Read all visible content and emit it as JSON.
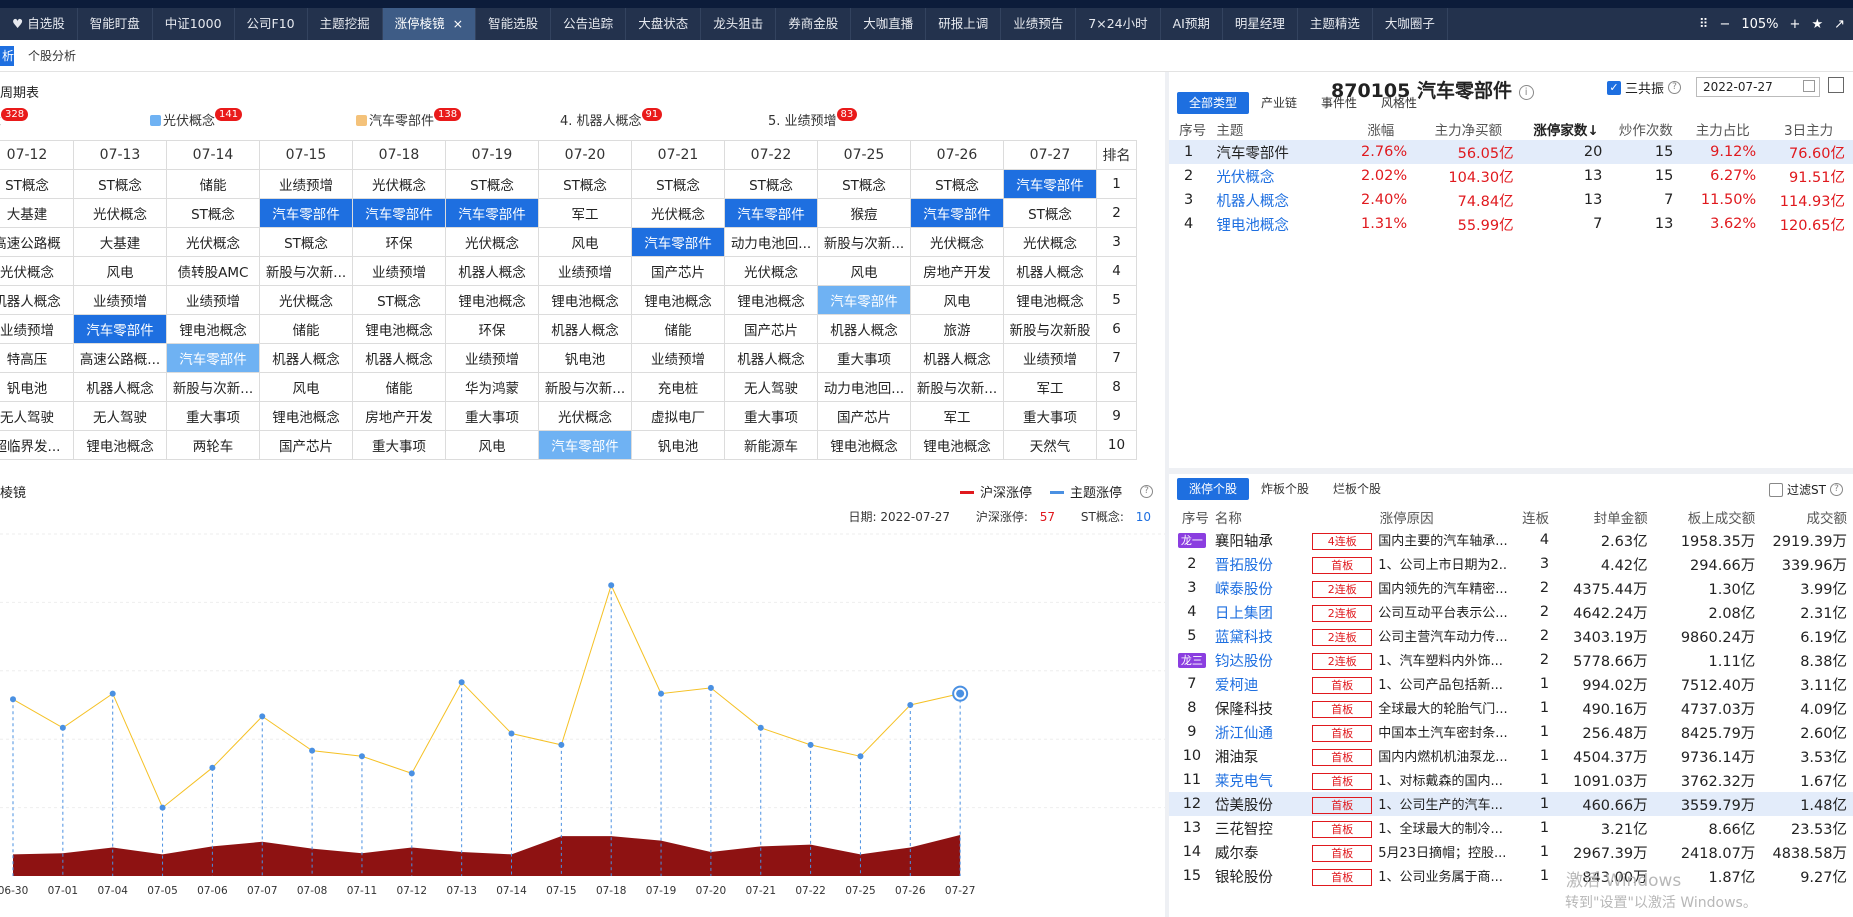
{
  "tabs": [
    "自选股",
    "智能盯盘",
    "中证1000",
    "公司F10",
    "主题挖掘",
    "涨停棱镜",
    "智能选股",
    "公告追踪",
    "大盘状态",
    "龙头狙击",
    "券商金股",
    "大咖直播",
    "研报上调",
    "业绩预告",
    "7×24小时",
    "AI预期",
    "明星经理",
    "主题精选",
    "大咖圈子"
  ],
  "active_tab": "涨停棱镜",
  "zoom": "105%",
  "subbar": {
    "left": "析",
    "right": "个股分析"
  },
  "rotation": {
    "title": "周期表",
    "pills": [
      {
        "label": "念",
        "badge": "328"
      },
      {
        "label": "光伏概念",
        "badge": "141"
      },
      {
        "label": "汽车零部件",
        "badge": "138"
      },
      {
        "label": "4. 机器人概念",
        "badge": "91"
      },
      {
        "label": "5. 业绩预增",
        "badge": "83"
      }
    ],
    "dates": [
      "07-12",
      "07-13",
      "07-14",
      "07-15",
      "07-18",
      "07-19",
      "07-20",
      "07-21",
      "07-22",
      "07-25",
      "07-26",
      "07-27"
    ],
    "rank_label": "排名",
    "rows": [
      [
        "ST概念",
        "ST概念",
        "储能",
        "业绩预增",
        "光伏概念",
        "ST概念",
        "ST概念",
        "ST概念",
        "ST概念",
        "ST概念",
        "ST概念",
        "汽车零部件"
      ],
      [
        "大基建",
        "光伏概念",
        "ST概念",
        "汽车零部件",
        "汽车零部件",
        "汽车零部件",
        "军工",
        "光伏概念",
        "汽车零部件",
        "猴痘",
        "汽车零部件",
        "ST概念"
      ],
      [
        "高速公路概",
        "大基建",
        "光伏概念",
        "ST概念",
        "环保",
        "光伏概念",
        "风电",
        "汽车零部件",
        "动力电池回...",
        "新股与次新...",
        "光伏概念",
        "光伏概念"
      ],
      [
        "光伏概念",
        "风电",
        "债转股AMC",
        "新股与次新...",
        "业绩预增",
        "机器人概念",
        "业绩预增",
        "国产芯片",
        "光伏概念",
        "风电",
        "房地产开发",
        "机器人概念"
      ],
      [
        "机器人概念",
        "业绩预增",
        "业绩预增",
        "光伏概念",
        "ST概念",
        "锂电池概念",
        "锂电池概念",
        "锂电池概念",
        "锂电池概念",
        "汽车零部件",
        "风电",
        "锂电池概念"
      ],
      [
        "业绩预增",
        "汽车零部件",
        "锂电池概念",
        "储能",
        "锂电池概念",
        "环保",
        "机器人概念",
        "储能",
        "国产芯片",
        "机器人概念",
        "旅游",
        "新股与次新股"
      ],
      [
        "特高压",
        "高速公路概...",
        "汽车零部件",
        "机器人概念",
        "机器人概念",
        "业绩预增",
        "钒电池",
        "业绩预增",
        "机器人概念",
        "重大事项",
        "机器人概念",
        "业绩预增"
      ],
      [
        "钒电池",
        "机器人概念",
        "新股与次新...",
        "风电",
        "储能",
        "华为鸿蒙",
        "新股与次新...",
        "充电桩",
        "无人驾驶",
        "动力电池回...",
        "新股与次新...",
        "军工"
      ],
      [
        "无人驾驶",
        "无人驾驶",
        "重大事项",
        "锂电池概念",
        "房地产开发",
        "重大事项",
        "光伏概念",
        "虚拟电厂",
        "重大事项",
        "国产芯片",
        "军工",
        "重大事项"
      ],
      [
        "超临界发...",
        "锂电池概念",
        "两轮车",
        "国产芯片",
        "重大事项",
        "风电",
        "汽车零部件",
        "钒电池",
        "新能源车",
        "锂电池概念",
        "锂电池概念",
        "天然气"
      ]
    ],
    "highlights": [
      {
        "r": 0,
        "c": 11,
        "k": "c1"
      },
      {
        "r": 1,
        "c": 3,
        "k": "c1"
      },
      {
        "r": 1,
        "c": 4,
        "k": "c1"
      },
      {
        "r": 1,
        "c": 5,
        "k": "c1"
      },
      {
        "r": 1,
        "c": 8,
        "k": "c1"
      },
      {
        "r": 1,
        "c": 10,
        "k": "c1"
      },
      {
        "r": 2,
        "c": 7,
        "k": "c1"
      },
      {
        "r": 4,
        "c": 9,
        "k": "c2"
      },
      {
        "r": 5,
        "c": 1,
        "k": "c1"
      },
      {
        "r": 6,
        "c": 2,
        "k": "c2"
      },
      {
        "r": 9,
        "c": 6,
        "k": "c2"
      }
    ]
  },
  "prism": {
    "title": "棱镜",
    "legend": [
      {
        "label": "沪深涨停",
        "color": "#e0191e"
      },
      {
        "label": "主题涨停",
        "color": "#4a90e2"
      }
    ],
    "info": {
      "date_label": "日期:",
      "date": "2022-07-27",
      "hs_label": "沪深涨停:",
      "hs": "57",
      "st_label": "ST概念:",
      "st": "10"
    }
  },
  "chart_data": {
    "type": "line",
    "x": [
      "06-30",
      "07-01",
      "07-04",
      "07-05",
      "07-06",
      "07-07",
      "07-08",
      "07-11",
      "07-12",
      "07-13",
      "07-14",
      "07-15",
      "07-18",
      "07-19",
      "07-20",
      "07-21",
      "07-22",
      "07-25",
      "07-26",
      "07-27"
    ],
    "series": [
      {
        "name": "主题涨停",
        "values": [
          31,
          26,
          32,
          12,
          19,
          28,
          22,
          21,
          18,
          34,
          25,
          23,
          51,
          32,
          33,
          26,
          23,
          21,
          30,
          32
        ]
      },
      {
        "name": "沪深涨停",
        "values": [
          38,
          40,
          50,
          38,
          52,
          60,
          48,
          40,
          50,
          42,
          38,
          70,
          70,
          62,
          42,
          52,
          55,
          38,
          50,
          72
        ]
      }
    ]
  },
  "theme_panel": {
    "code": "870105",
    "name": "汽车零部件",
    "resonance_label": "三共振",
    "date": "2022-07-27",
    "tabs": [
      "全部类型",
      "产业链",
      "事件性",
      "风格性"
    ],
    "headers": [
      "序号",
      "主题",
      "涨幅",
      "主力净买额",
      "涨停家数↓",
      "炒作次数",
      "主力占比",
      "3日主力"
    ],
    "rows": [
      [
        "1",
        "汽车零部件",
        "2.76%",
        "56.05亿",
        "20",
        "15",
        "9.12%",
        "76.60亿"
      ],
      [
        "2",
        "光伏概念",
        "2.02%",
        "104.30亿",
        "13",
        "15",
        "6.27%",
        "91.51亿"
      ],
      [
        "3",
        "机器人概念",
        "2.40%",
        "74.84亿",
        "13",
        "7",
        "11.50%",
        "114.93亿"
      ],
      [
        "4",
        "锂电池概念",
        "1.31%",
        "55.99亿",
        "7",
        "13",
        "3.62%",
        "120.65亿"
      ]
    ]
  },
  "stock_panel": {
    "tabs": [
      "涨停个股",
      "炸板个股",
      "烂板个股"
    ],
    "filter_label": "过滤ST",
    "headers": [
      "序号",
      "名称",
      "涨停原因",
      "连板",
      "封单金额",
      "板上成交额",
      "成交额"
    ],
    "rows": [
      [
        "龙一",
        "襄阳轴承",
        "4连板",
        "国内主要的汽车轴承...",
        "4",
        "2.63亿",
        "1958.35万",
        "2919.39万"
      ],
      [
        "2",
        "晋拓股份",
        "首板",
        "1、公司上市日期为2...",
        "3",
        "4.42亿",
        "294.66万",
        "339.96万"
      ],
      [
        "3",
        "嵘泰股份",
        "2连板",
        "国内领先的汽车精密...",
        "2",
        "4375.44万",
        "1.30亿",
        "3.99亿"
      ],
      [
        "4",
        "日上集团",
        "2连板",
        "公司互动平台表示公...",
        "2",
        "4642.24万",
        "2.08亿",
        "2.31亿"
      ],
      [
        "5",
        "蓝黛科技",
        "2连板",
        "公司主营汽车动力传...",
        "2",
        "3403.19万",
        "9860.24万",
        "6.19亿"
      ],
      [
        "龙三",
        "钧达股份",
        "2连板",
        "1、汽车塑料内外饰...",
        "2",
        "5778.66万",
        "1.11亿",
        "8.38亿"
      ],
      [
        "7",
        "爱柯迪",
        "首板",
        "1、公司产品包括新...",
        "1",
        "994.02万",
        "7512.40万",
        "3.11亿"
      ],
      [
        "8",
        "保隆科技",
        "首板",
        "全球最大的轮胎气门...",
        "1",
        "490.16万",
        "4737.03万",
        "4.09亿"
      ],
      [
        "9",
        "浙江仙通",
        "首板",
        "中国本土汽车密封条...",
        "1",
        "256.48万",
        "8425.79万",
        "2.60亿"
      ],
      [
        "10",
        "湘油泵",
        "首板",
        "国内内燃机机油泵龙...",
        "1",
        "4504.37万",
        "9736.14万",
        "3.53亿"
      ],
      [
        "11",
        "莱克电气",
        "首板",
        "1、对标戴森的国内...",
        "1",
        "1091.03万",
        "3762.32万",
        "1.67亿"
      ],
      [
        "12",
        "岱美股份",
        "首板",
        "1、公司生产的汽车...",
        "1",
        "460.66万",
        "3559.79万",
        "1.48亿"
      ],
      [
        "13",
        "三花智控",
        "首板",
        "1、全球最大的制冷...",
        "1",
        "3.21亿",
        "8.66亿",
        "23.53亿"
      ],
      [
        "14",
        "威尔泰",
        "首板",
        "5月23日摘帽；控股...",
        "1",
        "2967.39万",
        "2418.07万",
        "4838.58万"
      ],
      [
        "15",
        "银轮股份",
        "首板",
        "1、公司业务属于商...",
        "1",
        "843.00万",
        "1.87亿",
        "9.27亿"
      ]
    ],
    "blue_names": [
      "晋拓股份",
      "嵘泰股份",
      "日上集团",
      "蓝黛科技",
      "钧达股份",
      "爱柯迪",
      "浙江仙通",
      "莱克电气"
    ]
  },
  "watermark": {
    "line1": "激活 Windows",
    "line2": "转到\"设置\"以激活 Windows。"
  }
}
